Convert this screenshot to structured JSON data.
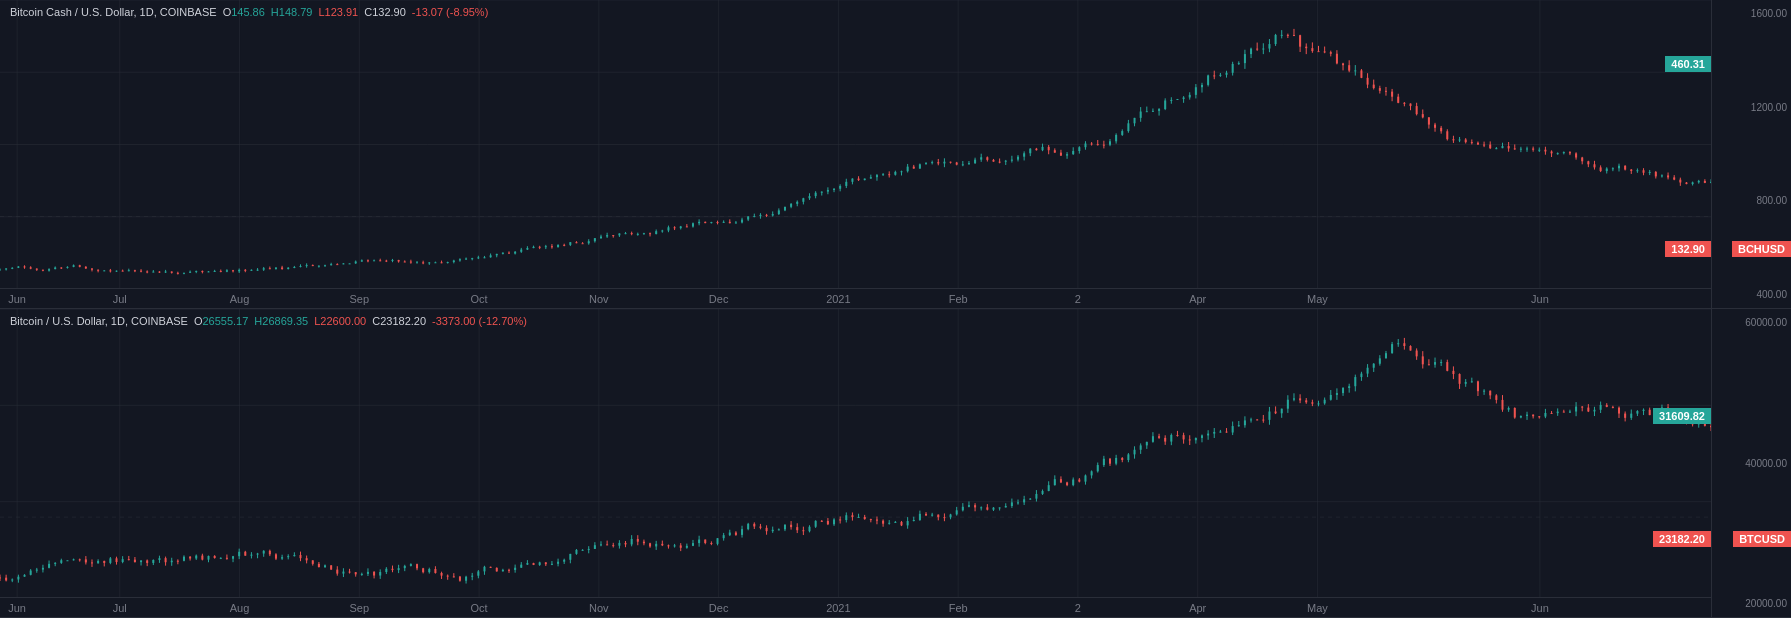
{
  "charts": [
    {
      "id": "bch-chart",
      "title": "Bitcoin Cash / U.S. Dollar, 1D, COINBASE",
      "symbol": "BCHUSD",
      "currency": "USD",
      "ohlc": {
        "o_label": "O",
        "o_value": "145.86",
        "h_label": "H",
        "h_value": "148.79",
        "l_label": "L",
        "l_value": "123.91",
        "c_label": "C",
        "c_value": "132.90",
        "change": "-13.07",
        "change_pct": "-8.95%"
      },
      "price_badge_top": "460.31",
      "price_badge_bottom": "132.90",
      "y_labels": [
        "1600.00",
        "1200.00",
        "800.00",
        "400.00"
      ],
      "x_labels": [
        "Jun",
        "Jul",
        "Aug",
        "Sep",
        "Oct",
        "Nov",
        "Dec",
        "2021",
        "Feb",
        "2",
        "Apr",
        "May",
        "Jun"
      ],
      "x_positions": [
        0.01,
        0.07,
        0.14,
        0.21,
        0.28,
        0.35,
        0.42,
        0.49,
        0.56,
        0.63,
        0.7,
        0.77,
        0.9
      ]
    },
    {
      "id": "btc-chart",
      "title": "Bitcoin / U.S. Dollar, 1D, COINBASE",
      "symbol": "BTCUSD",
      "currency": "USD",
      "ohlc": {
        "o_label": "O",
        "o_value": "26555.17",
        "h_label": "H",
        "h_value": "26869.35",
        "l_label": "L",
        "l_value": "22600.00",
        "c_label": "C",
        "c_value": "23182.20",
        "change": "-3373.00",
        "change_pct": "-12.70%"
      },
      "price_badge_top": "31609.82",
      "price_badge_bottom": "23182.20",
      "y_labels": [
        "60000.00",
        "40000.00",
        "20000.00"
      ],
      "x_labels": [
        "Jun",
        "Jul",
        "Aug",
        "Sep",
        "Oct",
        "Nov",
        "Dec",
        "2021",
        "Feb",
        "2",
        "Apr",
        "May",
        "Jun"
      ],
      "x_positions": [
        0.01,
        0.07,
        0.14,
        0.21,
        0.28,
        0.35,
        0.42,
        0.49,
        0.56,
        0.63,
        0.7,
        0.77,
        0.9
      ]
    }
  ],
  "colors": {
    "background": "#131722",
    "text": "#d1d4dc",
    "muted": "#787b86",
    "green": "#26a69a",
    "red": "#ef5350",
    "grid": "#2a2e39"
  }
}
